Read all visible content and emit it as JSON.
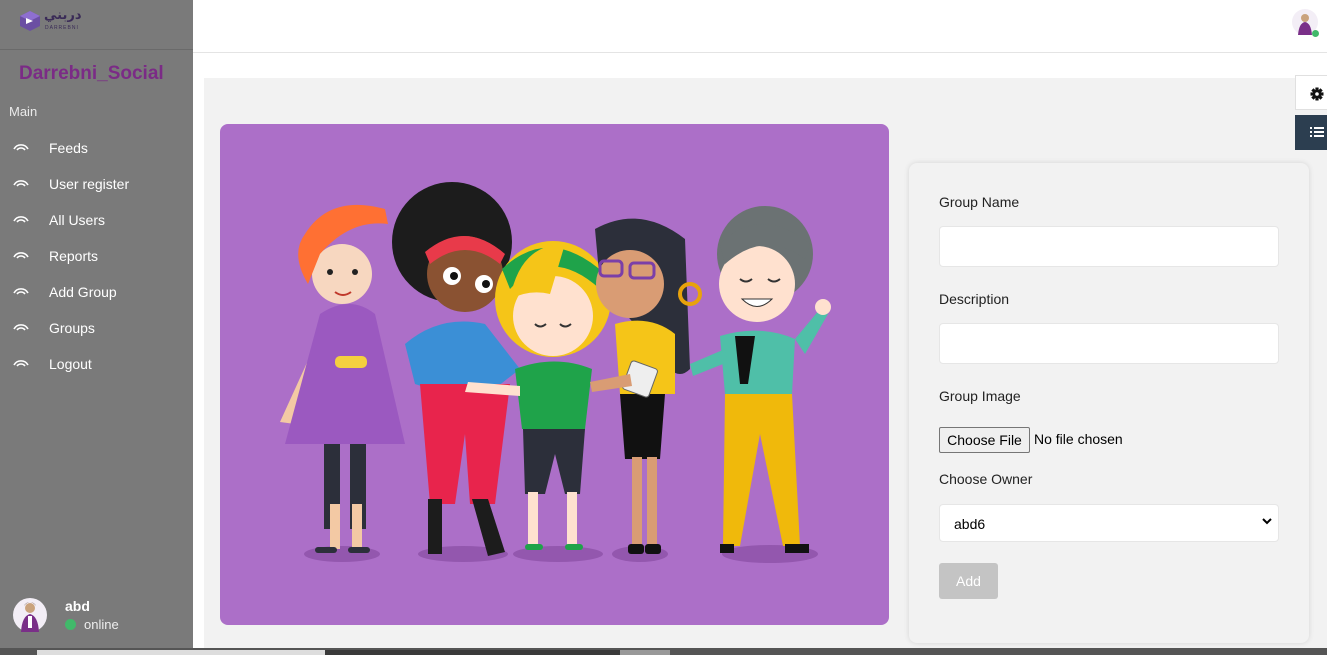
{
  "logo": {
    "arabic_text": "دربني",
    "latin_text": "DARREBNI"
  },
  "sidebar": {
    "brand": "Darrebni_Social",
    "section_label": "Main",
    "items": [
      {
        "label": "Feeds"
      },
      {
        "label": "User register"
      },
      {
        "label": "All Users"
      },
      {
        "label": "Reports"
      },
      {
        "label": "Add Group"
      },
      {
        "label": "Groups"
      },
      {
        "label": "Logout"
      }
    ],
    "user": {
      "name": "abd",
      "status": "online"
    }
  },
  "form": {
    "group_name_label": "Group Name",
    "group_name_value": "",
    "description_label": "Description",
    "description_value": "",
    "group_image_label": "Group Image",
    "file_button": "Choose File",
    "file_status": "No file chosen",
    "owner_label": "Choose Owner",
    "owner_selected": "abd6",
    "submit_label": "Add"
  },
  "colors": {
    "sidebar_bg": "#7a7a7a",
    "brand": "#7b2b86",
    "hero_bg": "#ac6fc8",
    "online": "#41b96a",
    "list_tab": "#2c3e50"
  },
  "icons": {
    "nav": "wifi-arc-icon",
    "settings": "gear-icon",
    "list": "list-icon",
    "select": "chevron-down-icon"
  }
}
